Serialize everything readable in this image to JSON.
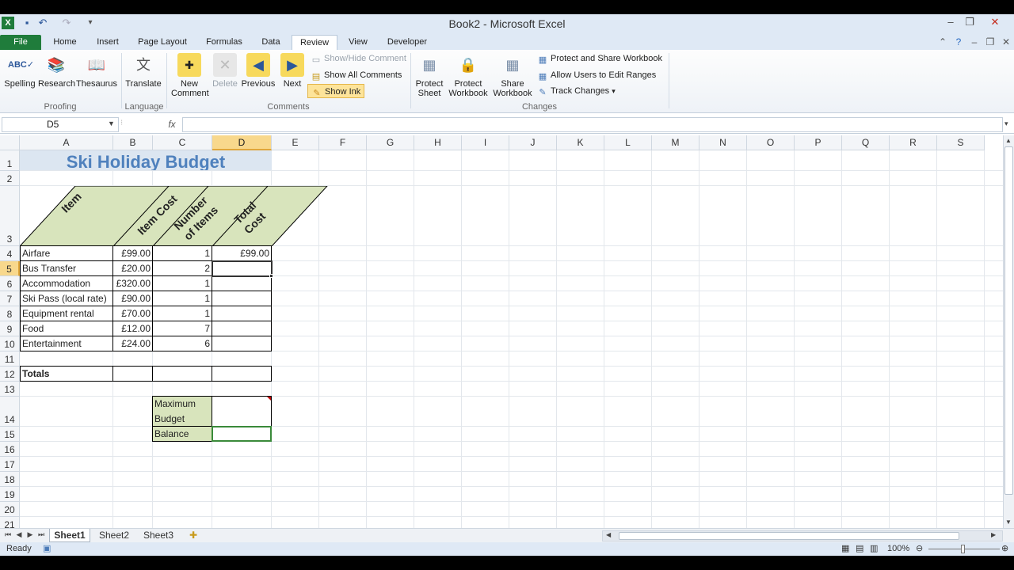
{
  "window": {
    "title": "Book2 - Microsoft Excel",
    "min_icon": "minimize-icon",
    "restore_icon": "restore-icon",
    "close_icon": "close-icon"
  },
  "tabs": [
    "File",
    "Home",
    "Insert",
    "Page Layout",
    "Formulas",
    "Data",
    "Review",
    "View",
    "Developer"
  ],
  "active_tab": "Review",
  "ribbon": {
    "proofing": {
      "label": "Proofing",
      "spelling": "Spelling",
      "research": "Research",
      "thesaurus": "Thesaurus"
    },
    "language": {
      "label": "Language",
      "translate": "Translate"
    },
    "comments": {
      "label": "Comments",
      "new_comment": "New Comment",
      "delete": "Delete",
      "previous": "Previous",
      "next": "Next",
      "show_hide": "Show/Hide Comment",
      "show_all": "Show All Comments",
      "show_ink": "Show Ink"
    },
    "changes": {
      "label": "Changes",
      "protect_sheet": "Protect Sheet",
      "protect_workbook": "Protect Workbook",
      "share_workbook": "Share Workbook",
      "protect_share": "Protect and Share Workbook",
      "allow_users": "Allow Users to Edit Ranges",
      "track_changes": "Track Changes"
    }
  },
  "formula_bar": {
    "name_box": "D5",
    "fx": "fx",
    "value": ""
  },
  "columns": [
    "A",
    "B",
    "C",
    "D",
    "E",
    "F",
    "G",
    "H",
    "I",
    "J",
    "K",
    "L",
    "M",
    "N",
    "O",
    "P",
    "Q",
    "R",
    "S"
  ],
  "rows": [
    "1",
    "2",
    "3",
    "4",
    "5",
    "6",
    "7",
    "8",
    "9",
    "10",
    "11",
    "12",
    "13",
    "14",
    "15",
    "16",
    "17",
    "18",
    "19",
    "20",
    "21"
  ],
  "sheet": {
    "title": "Ski Holiday Budget",
    "headers": {
      "item": "Item",
      "item_cost": "Item Cost",
      "number": "Number of Items",
      "total": "Total Cost"
    },
    "items": [
      {
        "name": "Airfare",
        "cost": "£99.00",
        "qty": "1",
        "total": "£99.00"
      },
      {
        "name": "Bus Transfer",
        "cost": "£20.00",
        "qty": "2",
        "total": ""
      },
      {
        "name": "Accommodation",
        "cost": "£320.00",
        "qty": "1",
        "total": ""
      },
      {
        "name": "Ski Pass (local rate)",
        "cost": "£90.00",
        "qty": "1",
        "total": ""
      },
      {
        "name": "Equipment rental",
        "cost": "£70.00",
        "qty": "1",
        "total": ""
      },
      {
        "name": "Food",
        "cost": "£12.00",
        "qty": "7",
        "total": ""
      },
      {
        "name": "Entertainment",
        "cost": "£24.00",
        "qty": "6",
        "total": ""
      }
    ],
    "totals_label": "Totals",
    "max_budget_label": "Maximum Budget",
    "balance_label": "Balance"
  },
  "sheets": [
    "Sheet1",
    "Sheet2",
    "Sheet3"
  ],
  "active_sheet": "Sheet1",
  "status": {
    "ready": "Ready",
    "zoom": "100%"
  }
}
